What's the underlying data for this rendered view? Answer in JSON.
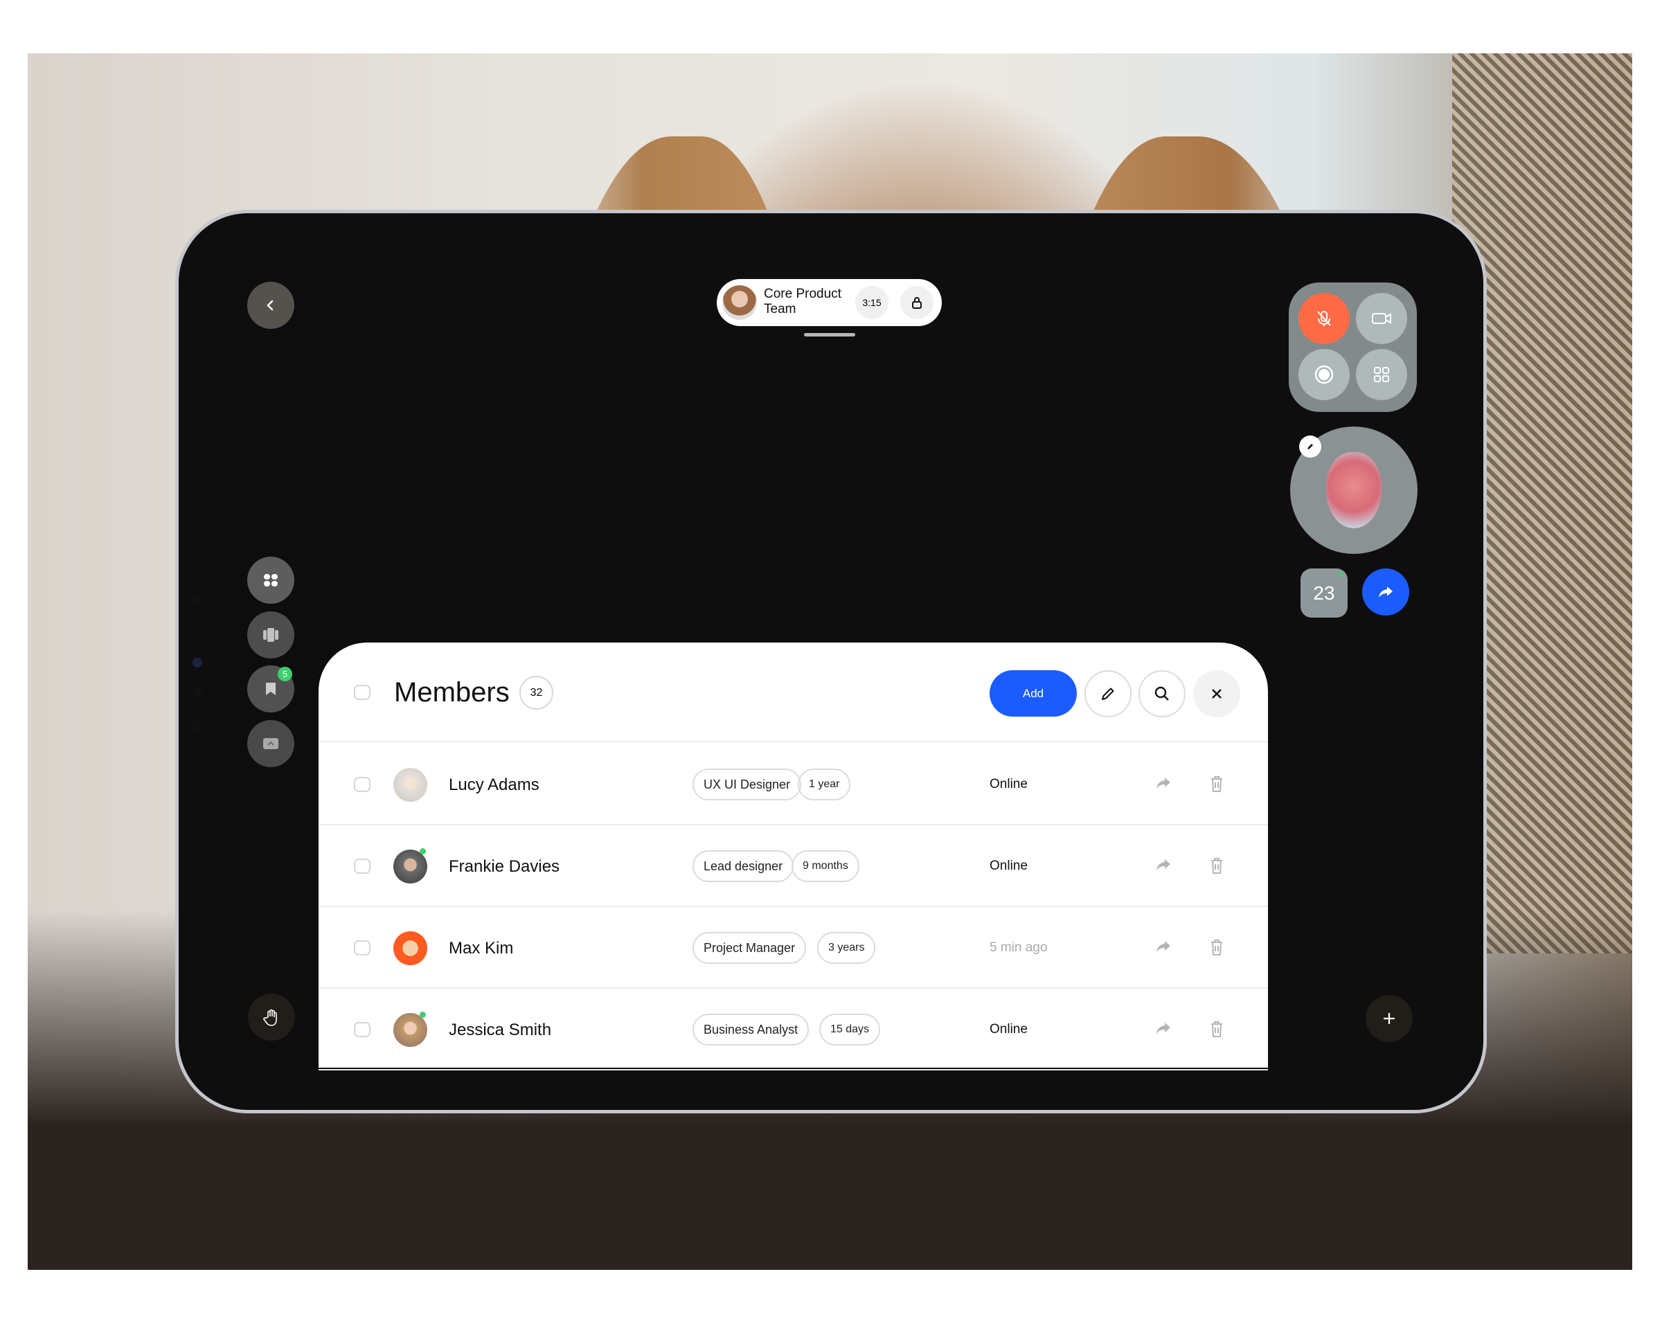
{
  "call": {
    "title": "Core Product Team",
    "timer": "3:15"
  },
  "sidebar": {
    "bookmark_badge": "5"
  },
  "controls": {
    "participants_count": "23",
    "mic_color": "#ff6b45",
    "accent": "#1a5cff"
  },
  "members": {
    "title": "Members",
    "count": "32",
    "add_label": "Add",
    "rows": [
      {
        "name": "Lucy Adams",
        "role": "UX UI Designer",
        "tenure": "1 year",
        "status": "Online",
        "online": true
      },
      {
        "name": "Frankie Davies",
        "role": "Lead designer",
        "tenure": "9 months",
        "status": "Online",
        "online": true
      },
      {
        "name": "Max Kim",
        "role": "Project Manager",
        "tenure": "3 years",
        "status": "5 min ago",
        "online": false
      },
      {
        "name": "Jessica Smith",
        "role": "Business Analyst",
        "tenure": "15 days",
        "status": "Online",
        "online": true
      }
    ]
  }
}
